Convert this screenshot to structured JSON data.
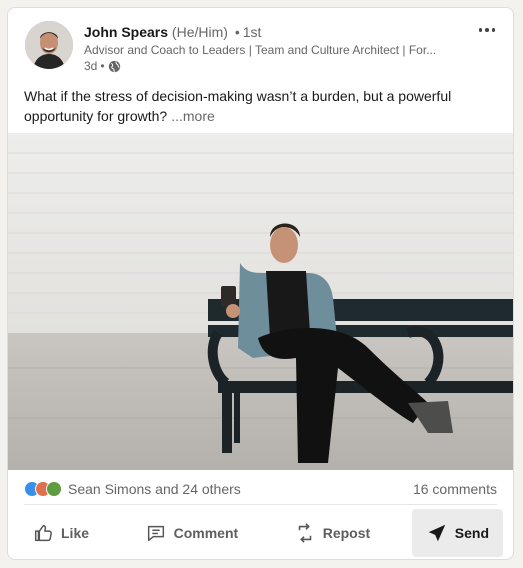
{
  "author": {
    "name": "John Spears",
    "pronouns": "(He/Him)",
    "separator": "•",
    "degree": "1st",
    "headline": "Advisor and Coach to Leaders | Team and Culture Architect | For...",
    "time_ago": "3d",
    "time_separator": "•"
  },
  "post": {
    "text": "What if the stress of decision-making wasn’t a burden, but a powerful opportunity for growth?",
    "see_more": "...more"
  },
  "social": {
    "reactions": [
      "like",
      "celebrate",
      "support"
    ],
    "reactors": "Sean Simons and 24 others",
    "comments": "16 comments"
  },
  "actions": {
    "like": "Like",
    "comment": "Comment",
    "repost": "Repost",
    "send": "Send"
  },
  "colors": {
    "like": "#378fe9",
    "celebrate": "#df704d",
    "support": "#5f9b41"
  }
}
